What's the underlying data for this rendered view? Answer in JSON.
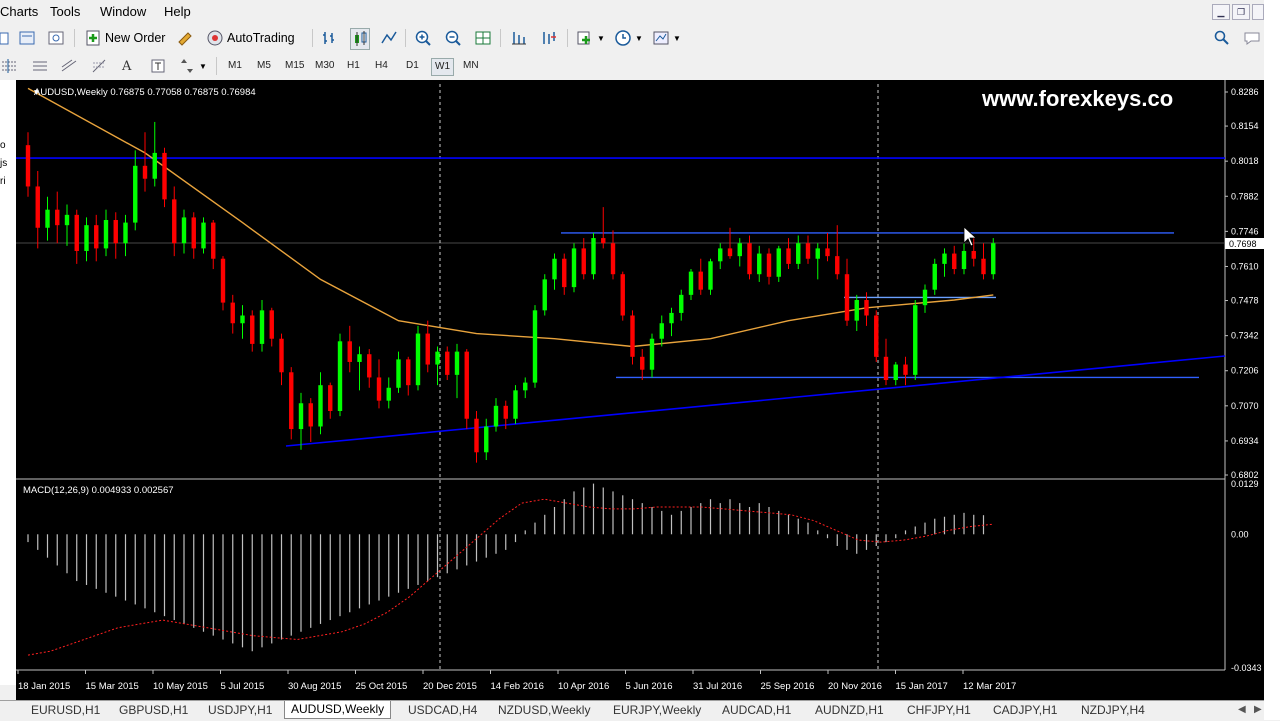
{
  "menu": {
    "items": [
      "Charts",
      "Tools",
      "Window",
      "Help"
    ]
  },
  "toolbar": {
    "new_order": "New Order",
    "auto_trading": "AutoTrading"
  },
  "timeframes": [
    "M1",
    "M5",
    "M15",
    "M30",
    "H1",
    "H4",
    "D1",
    "W1",
    "MN"
  ],
  "timeframe_active": "W1",
  "left_panel": {
    "fragments": [
      "o",
      "js",
      "ri"
    ]
  },
  "chart": {
    "header": "AUDUSD,Weekly  0.76875 0.77058 0.76875 0.76984",
    "watermark": "www.forexkeys.co",
    "price_ticks": [
      "0.8286",
      "0.8154",
      "0.8018",
      "0.7882",
      "0.7746",
      "0.7610",
      "0.7478",
      "0.7342",
      "0.7206",
      "0.7070",
      "0.6934",
      "0.6802"
    ],
    "current_price": "0.7698",
    "macd_header": "MACD(12,26,9) 0.004933 0.002567",
    "macd_ticks": [
      "0.0129",
      "0.00",
      "-0.0343"
    ],
    "date_labels": [
      "18 Jan 2015",
      "15 Mar 2015",
      "10 May 2015",
      "5 Jul 2015",
      "30 Aug 2015",
      "25 Oct 2015",
      "20 Dec 2015",
      "14 Feb 2016",
      "10 Apr 2016",
      "5 Jun 2016",
      "31 Jul 2016",
      "25 Sep 2016",
      "20 Nov 2016",
      "15 Jan 2017",
      "12 Mar 2017"
    ],
    "colors": {
      "bull": "#00ff00",
      "bear": "#ff0000",
      "ma": "#e8a33c",
      "trendline": "#0000ff",
      "level": "#3060ff",
      "macd_hist": "#c0c0c0",
      "macd_signal": "#ff2020"
    }
  },
  "tabs": [
    "EURUSD,H1",
    "GBPUSD,H1",
    "USDJPY,H1",
    "AUDUSD,Weekly",
    "USDCAD,H4",
    "NZDUSD,Weekly",
    "EURJPY,Weekly",
    "AUDCAD,H1",
    "AUDNZD,H1",
    "CHFJPY,H1",
    "CADJPY,H1",
    "NZDJPY,H4"
  ],
  "active_tab": "AUDUSD,Weekly",
  "chart_data": {
    "type": "candlestick",
    "title": "AUDUSD,Weekly",
    "ylim": [
      0.6802,
      0.8286
    ],
    "ohlc": [
      [
        0.808,
        0.813,
        0.788,
        0.792
      ],
      [
        0.792,
        0.798,
        0.768,
        0.776
      ],
      [
        0.776,
        0.788,
        0.771,
        0.783
      ],
      [
        0.783,
        0.79,
        0.77,
        0.777
      ],
      [
        0.777,
        0.785,
        0.769,
        0.781
      ],
      [
        0.781,
        0.783,
        0.762,
        0.767
      ],
      [
        0.767,
        0.78,
        0.763,
        0.777
      ],
      [
        0.777,
        0.781,
        0.763,
        0.768
      ],
      [
        0.768,
        0.783,
        0.765,
        0.779
      ],
      [
        0.779,
        0.782,
        0.764,
        0.77
      ],
      [
        0.77,
        0.781,
        0.765,
        0.778
      ],
      [
        0.778,
        0.806,
        0.775,
        0.8
      ],
      [
        0.8,
        0.813,
        0.79,
        0.795
      ],
      [
        0.795,
        0.817,
        0.792,
        0.805
      ],
      [
        0.805,
        0.807,
        0.784,
        0.787
      ],
      [
        0.787,
        0.792,
        0.765,
        0.77
      ],
      [
        0.77,
        0.783,
        0.766,
        0.78
      ],
      [
        0.78,
        0.782,
        0.764,
        0.768
      ],
      [
        0.768,
        0.78,
        0.766,
        0.778
      ],
      [
        0.778,
        0.779,
        0.76,
        0.764
      ],
      [
        0.764,
        0.765,
        0.744,
        0.747
      ],
      [
        0.747,
        0.75,
        0.735,
        0.739
      ],
      [
        0.739,
        0.746,
        0.733,
        0.742
      ],
      [
        0.742,
        0.744,
        0.728,
        0.731
      ],
      [
        0.731,
        0.748,
        0.728,
        0.744
      ],
      [
        0.744,
        0.745,
        0.73,
        0.733
      ],
      [
        0.733,
        0.735,
        0.715,
        0.72
      ],
      [
        0.72,
        0.722,
        0.694,
        0.698
      ],
      [
        0.698,
        0.712,
        0.69,
        0.708
      ],
      [
        0.708,
        0.71,
        0.693,
        0.699
      ],
      [
        0.699,
        0.72,
        0.696,
        0.715
      ],
      [
        0.715,
        0.716,
        0.702,
        0.705
      ],
      [
        0.705,
        0.735,
        0.703,
        0.732
      ],
      [
        0.732,
        0.738,
        0.72,
        0.724
      ],
      [
        0.724,
        0.73,
        0.713,
        0.727
      ],
      [
        0.727,
        0.729,
        0.714,
        0.718
      ],
      [
        0.718,
        0.725,
        0.706,
        0.709
      ],
      [
        0.709,
        0.718,
        0.706,
        0.714
      ],
      [
        0.714,
        0.728,
        0.712,
        0.725
      ],
      [
        0.725,
        0.726,
        0.711,
        0.715
      ],
      [
        0.715,
        0.738,
        0.713,
        0.735
      ],
      [
        0.735,
        0.74,
        0.72,
        0.723
      ],
      [
        0.723,
        0.73,
        0.715,
        0.728
      ],
      [
        0.728,
        0.73,
        0.717,
        0.719
      ],
      [
        0.719,
        0.731,
        0.71,
        0.728
      ],
      [
        0.728,
        0.729,
        0.698,
        0.702
      ],
      [
        0.702,
        0.705,
        0.685,
        0.689
      ],
      [
        0.689,
        0.702,
        0.686,
        0.699
      ],
      [
        0.699,
        0.71,
        0.697,
        0.707
      ],
      [
        0.707,
        0.709,
        0.698,
        0.702
      ],
      [
        0.702,
        0.715,
        0.7,
        0.713
      ],
      [
        0.713,
        0.718,
        0.71,
        0.716
      ],
      [
        0.716,
        0.746,
        0.714,
        0.744
      ],
      [
        0.744,
        0.758,
        0.742,
        0.756
      ],
      [
        0.756,
        0.766,
        0.752,
        0.764
      ],
      [
        0.764,
        0.766,
        0.75,
        0.753
      ],
      [
        0.753,
        0.77,
        0.751,
        0.768
      ],
      [
        0.768,
        0.772,
        0.756,
        0.758
      ],
      [
        0.758,
        0.774,
        0.756,
        0.772
      ],
      [
        0.772,
        0.784,
        0.768,
        0.77
      ],
      [
        0.77,
        0.775,
        0.756,
        0.758
      ],
      [
        0.758,
        0.759,
        0.74,
        0.742
      ],
      [
        0.742,
        0.744,
        0.723,
        0.726
      ],
      [
        0.726,
        0.729,
        0.717,
        0.721
      ],
      [
        0.721,
        0.735,
        0.718,
        0.733
      ],
      [
        0.733,
        0.742,
        0.73,
        0.739
      ],
      [
        0.739,
        0.745,
        0.734,
        0.743
      ],
      [
        0.743,
        0.752,
        0.74,
        0.75
      ],
      [
        0.75,
        0.76,
        0.748,
        0.759
      ],
      [
        0.759,
        0.764,
        0.75,
        0.752
      ],
      [
        0.752,
        0.764,
        0.75,
        0.763
      ],
      [
        0.763,
        0.77,
        0.76,
        0.768
      ],
      [
        0.768,
        0.776,
        0.764,
        0.765
      ],
      [
        0.765,
        0.772,
        0.761,
        0.77
      ],
      [
        0.77,
        0.773,
        0.756,
        0.758
      ],
      [
        0.758,
        0.769,
        0.755,
        0.766
      ],
      [
        0.766,
        0.768,
        0.754,
        0.757
      ],
      [
        0.757,
        0.769,
        0.755,
        0.768
      ],
      [
        0.768,
        0.772,
        0.76,
        0.762
      ],
      [
        0.762,
        0.773,
        0.76,
        0.77
      ],
      [
        0.77,
        0.773,
        0.762,
        0.764
      ],
      [
        0.764,
        0.77,
        0.756,
        0.768
      ],
      [
        0.768,
        0.774,
        0.763,
        0.765
      ],
      [
        0.765,
        0.777,
        0.756,
        0.758
      ],
      [
        0.758,
        0.764,
        0.738,
        0.74
      ],
      [
        0.74,
        0.75,
        0.736,
        0.748
      ],
      [
        0.748,
        0.751,
        0.738,
        0.742
      ],
      [
        0.742,
        0.744,
        0.724,
        0.726
      ],
      [
        0.726,
        0.733,
        0.715,
        0.717
      ],
      [
        0.717,
        0.724,
        0.715,
        0.723
      ],
      [
        0.723,
        0.726,
        0.715,
        0.719
      ],
      [
        0.719,
        0.748,
        0.717,
        0.746
      ],
      [
        0.746,
        0.754,
        0.743,
        0.752
      ],
      [
        0.752,
        0.764,
        0.75,
        0.762
      ],
      [
        0.762,
        0.768,
        0.757,
        0.766
      ],
      [
        0.766,
        0.769,
        0.758,
        0.76
      ],
      [
        0.76,
        0.77,
        0.758,
        0.767
      ],
      [
        0.767,
        0.772,
        0.761,
        0.764
      ],
      [
        0.764,
        0.77,
        0.756,
        0.758
      ],
      [
        0.758,
        0.772,
        0.756,
        0.77
      ]
    ],
    "ma_200": [
      [
        0,
        0.83
      ],
      [
        12,
        0.805
      ],
      [
        22,
        0.778
      ],
      [
        30,
        0.756
      ],
      [
        38,
        0.74
      ],
      [
        46,
        0.735
      ],
      [
        54,
        0.733
      ],
      [
        62,
        0.73
      ],
      [
        70,
        0.733
      ],
      [
        78,
        0.74
      ],
      [
        86,
        0.745
      ],
      [
        95,
        0.748
      ],
      [
        99,
        0.75
      ]
    ],
    "levels": [
      0.803,
      0.774,
      0.749,
      0.718
    ],
    "macd": {
      "ylim": [
        -0.0343,
        0.0129
      ],
      "histogram": [
        -0.002,
        -0.004,
        -0.006,
        -0.008,
        -0.01,
        -0.012,
        -0.013,
        -0.014,
        -0.015,
        -0.016,
        -0.017,
        -0.018,
        -0.019,
        -0.02,
        -0.021,
        -0.022,
        -0.023,
        -0.024,
        -0.025,
        -0.026,
        -0.027,
        -0.028,
        -0.029,
        -0.03,
        -0.029,
        -0.028,
        -0.027,
        -0.026,
        -0.025,
        -0.024,
        -0.023,
        -0.022,
        -0.021,
        -0.02,
        -0.019,
        -0.018,
        -0.017,
        -0.016,
        -0.015,
        -0.014,
        -0.013,
        -0.012,
        -0.011,
        -0.01,
        -0.009,
        -0.008,
        -0.007,
        -0.006,
        -0.005,
        -0.004,
        -0.002,
        0.001,
        0.003,
        0.005,
        0.007,
        0.009,
        0.011,
        0.012,
        0.013,
        0.012,
        0.011,
        0.01,
        0.009,
        0.008,
        0.007,
        0.006,
        0.005,
        0.006,
        0.007,
        0.008,
        0.009,
        0.008,
        0.009,
        0.008,
        0.007,
        0.008,
        0.007,
        0.006,
        0.005,
        0.004,
        0.003,
        0.001,
        -0.001,
        -0.003,
        -0.004,
        -0.005,
        -0.004,
        -0.003,
        -0.002,
        -0.001,
        0.001,
        0.002,
        0.003,
        0.004,
        0.0045,
        0.005,
        0.0055,
        0.005,
        0.0049
      ],
      "signal": [
        -0.031,
        -0.03,
        -0.028,
        -0.026,
        -0.024,
        -0.023,
        -0.022,
        -0.023,
        -0.024,
        -0.025,
        -0.026,
        -0.0265,
        -0.027,
        -0.026,
        -0.025,
        -0.023,
        -0.02,
        -0.016,
        -0.011,
        -0.006,
        -0.001,
        0.004,
        0.008,
        0.009,
        0.008,
        0.007,
        0.0065,
        0.0065,
        0.007,
        0.007,
        0.007,
        0.0065,
        0.006,
        0.0055,
        0.005,
        0.0035,
        0.001,
        -0.0015,
        -0.002,
        -0.0015,
        -0.0005,
        0.001,
        0.002,
        0.0026
      ]
    }
  }
}
